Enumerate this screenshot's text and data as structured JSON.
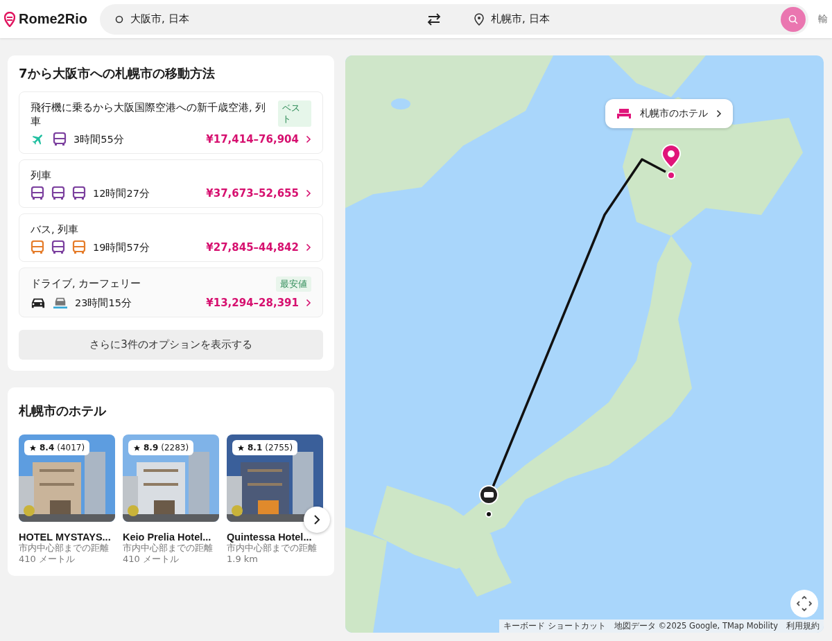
{
  "header": {
    "logo": "Rome2Rio",
    "origin": "大阪市, 日本",
    "destination": "札幌市, 日本",
    "cut_text": "輸"
  },
  "routes_panel": {
    "title": "7から大阪市への札幌市の移動方法",
    "routes": [
      {
        "title": "飛行機に乗るから大阪国際空港への新千歳空港, 列車",
        "badge": {
          "text": "ベスト",
          "kind": "best"
        },
        "modes": [
          {
            "kind": "plane"
          },
          {
            "kind": "train"
          }
        ],
        "duration": "3時間55分",
        "price": "¥17,414–76,904"
      },
      {
        "title": "列車",
        "modes": [
          {
            "kind": "train"
          },
          {
            "kind": "train"
          },
          {
            "kind": "train"
          }
        ],
        "duration": "12時間27分",
        "price": "¥37,673–52,655"
      },
      {
        "title": "バス, 列車",
        "modes": [
          {
            "kind": "bus"
          },
          {
            "kind": "train"
          },
          {
            "kind": "bus"
          }
        ],
        "duration": "19時間57分",
        "price": "¥27,845–44,842"
      },
      {
        "title": "ドライブ, カーフェリー",
        "badge": {
          "text": "最安値",
          "kind": "cheapest"
        },
        "modes": [
          {
            "kind": "car"
          },
          {
            "kind": "ferry"
          }
        ],
        "duration": "23時間15分",
        "price": "¥13,294–28,391"
      }
    ],
    "more_button": "さらに3件のオプションを表示する"
  },
  "hotels_panel": {
    "title": "札幌市のホテル",
    "hotels": [
      {
        "score": "8.4",
        "reviews": "(4017)",
        "name": "HOTEL MYSTAYS...",
        "distance_label": "市内中心部までの距離",
        "distance": "410 メートル",
        "kind": "picture"
      },
      {
        "score": "8.9",
        "reviews": "(2283)",
        "name": "Keio Prelia Hotel...",
        "distance_label": "市内中心部までの距離",
        "distance": "410 メートル",
        "kind": "picture"
      },
      {
        "score": "8.1",
        "reviews": "(2755)",
        "name": "Quintessa Hotel...",
        "distance_label": "市内中心部までの距離",
        "distance": "1.9 km",
        "kind": "picture"
      }
    ]
  },
  "map": {
    "popup": "札幌市のホテル",
    "attribution": [
      "キーボード ショートカット",
      "地図データ ©2025 Google, TMap Mobility",
      "利用規約"
    ]
  }
}
